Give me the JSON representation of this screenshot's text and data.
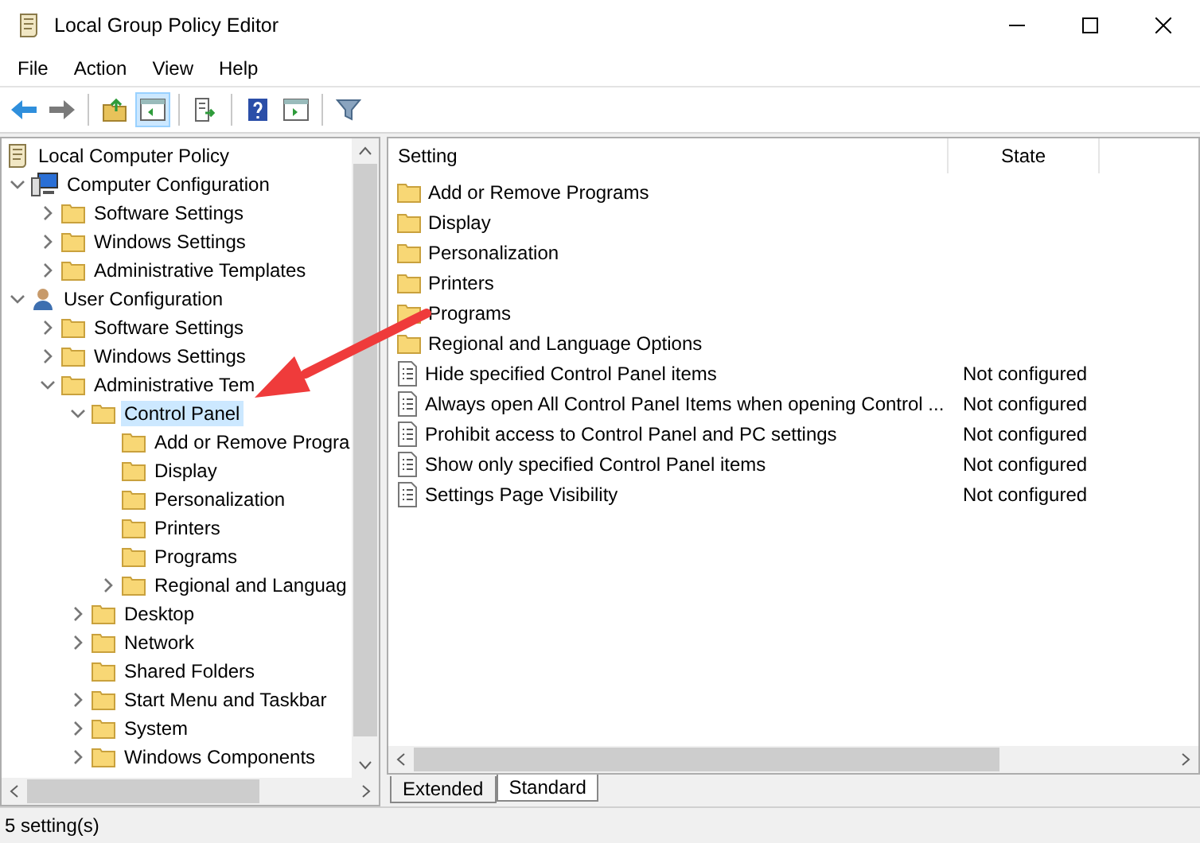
{
  "window": {
    "title": "Local Group Policy Editor"
  },
  "menu": [
    {
      "label": "File"
    },
    {
      "label": "Action"
    },
    {
      "label": "View"
    },
    {
      "label": "Help"
    }
  ],
  "toolbar": [
    {
      "kind": "back",
      "pressed": false
    },
    {
      "kind": "forward",
      "pressed": false
    },
    {
      "kind": "sep"
    },
    {
      "kind": "up",
      "pressed": false
    },
    {
      "kind": "tree",
      "pressed": true
    },
    {
      "kind": "sep"
    },
    {
      "kind": "export",
      "pressed": false
    },
    {
      "kind": "sep"
    },
    {
      "kind": "help",
      "pressed": false
    },
    {
      "kind": "pane",
      "pressed": false
    },
    {
      "kind": "sep"
    },
    {
      "kind": "filter",
      "pressed": false
    }
  ],
  "tree": [
    {
      "label": "Local Computer Policy",
      "kind": "root",
      "selected": false,
      "children": [
        {
          "label": "Computer Configuration",
          "kind": "computer",
          "expanded": true,
          "selected": false,
          "children": [
            {
              "label": "Software Settings",
              "kind": "folder",
              "expanded": false,
              "selected": false
            },
            {
              "label": "Windows Settings",
              "kind": "folder",
              "expanded": false,
              "selected": false
            },
            {
              "label": "Administrative Templates",
              "kind": "folder",
              "expanded": false,
              "selected": false
            }
          ]
        },
        {
          "label": "User Configuration",
          "kind": "user",
          "expanded": true,
          "selected": false,
          "children": [
            {
              "label": "Software Settings",
              "kind": "folder",
              "expanded": false,
              "selected": false
            },
            {
              "label": "Windows Settings",
              "kind": "folder",
              "expanded": false,
              "selected": false
            },
            {
              "label": "Administrative Tem",
              "kind": "folder",
              "expanded": true,
              "selected": false,
              "children": [
                {
                  "label": "Control Panel",
                  "kind": "folder",
                  "expanded": true,
                  "selected": true,
                  "children": [
                    {
                      "label": "Add or Remove Progra",
                      "kind": "folder",
                      "selected": false
                    },
                    {
                      "label": "Display",
                      "kind": "folder",
                      "selected": false
                    },
                    {
                      "label": "Personalization",
                      "kind": "folder",
                      "selected": false
                    },
                    {
                      "label": "Printers",
                      "kind": "folder",
                      "selected": false
                    },
                    {
                      "label": "Programs",
                      "kind": "folder",
                      "selected": false
                    },
                    {
                      "label": "Regional and Languag",
                      "kind": "folder",
                      "expanded": false,
                      "selected": false
                    }
                  ]
                },
                {
                  "label": "Desktop",
                  "kind": "folder",
                  "expanded": false,
                  "selected": false
                },
                {
                  "label": "Network",
                  "kind": "folder",
                  "expanded": false,
                  "selected": false
                },
                {
                  "label": "Shared Folders",
                  "kind": "folder",
                  "selected": false
                },
                {
                  "label": "Start Menu and Taskbar",
                  "kind": "folder",
                  "expanded": false,
                  "selected": false
                },
                {
                  "label": "System",
                  "kind": "folder",
                  "expanded": false,
                  "selected": false
                },
                {
                  "label": "Windows Components",
                  "kind": "folder",
                  "expanded": false,
                  "selected": false
                }
              ]
            }
          ]
        }
      ]
    }
  ],
  "list": {
    "columns": [
      "Setting",
      "State"
    ],
    "rows": [
      {
        "kind": "folder",
        "setting": "Add or Remove Programs"
      },
      {
        "kind": "folder",
        "setting": "Display"
      },
      {
        "kind": "folder",
        "setting": "Personalization"
      },
      {
        "kind": "folder",
        "setting": "Printers"
      },
      {
        "kind": "folder",
        "setting": "Programs"
      },
      {
        "kind": "folder",
        "setting": "Regional and Language Options"
      },
      {
        "kind": "policy",
        "setting": "Hide specified Control Panel items",
        "state": "Not configured"
      },
      {
        "kind": "policy",
        "setting": "Always open All Control Panel Items when opening Control ...",
        "state": "Not configured"
      },
      {
        "kind": "policy",
        "setting": "Prohibit access to Control Panel and PC settings",
        "state": "Not configured"
      },
      {
        "kind": "policy",
        "setting": "Show only specified Control Panel items",
        "state": "Not configured"
      },
      {
        "kind": "policy",
        "setting": "Settings Page Visibility",
        "state": "Not configured"
      }
    ]
  },
  "view_tabs": [
    {
      "label": "Extended",
      "selected": false
    },
    {
      "label": "Standard",
      "selected": true
    }
  ],
  "status_bar": "5 setting(s)"
}
